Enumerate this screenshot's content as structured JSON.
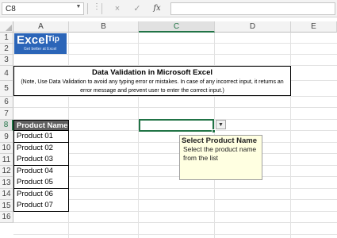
{
  "formula_bar": {
    "name_box": "C8",
    "cancel_icon": "×",
    "enter_icon": "✓",
    "function_icon": "fx",
    "formula": ""
  },
  "columns": [
    "A",
    "B",
    "C",
    "D",
    "E"
  ],
  "selected_column": "C",
  "rows": [
    "1",
    "2",
    "3",
    "4",
    "5",
    "6",
    "7",
    "8",
    "9",
    "10",
    "11",
    "12",
    "13",
    "14",
    "15",
    "16"
  ],
  "selected_row": "8",
  "logo": {
    "text": "Excel",
    "tip": "Tip",
    "tagline": "Get better at Excel"
  },
  "title_box": {
    "title": "Data Validation in Microsoft Excel",
    "note": "(Note, Use Data Validation to avoid any typing error or mistakes. In case of any incorrect input, it returns an error message and prevent user to enter the correct input.)"
  },
  "table": {
    "header": "Product Name",
    "items": [
      "Product 01",
      "Product 02",
      "Product 03",
      "Product 04",
      "Product 05",
      "Product 06",
      "Product 07"
    ]
  },
  "input_message": {
    "title": "Select Product Name",
    "body": "Select the product name from the list"
  },
  "colors": {
    "accent": "#217346",
    "logo_bg": "#2b65b8",
    "table_header_bg": "#5f5f5f",
    "tooltip_bg": "#ffffe1"
  }
}
